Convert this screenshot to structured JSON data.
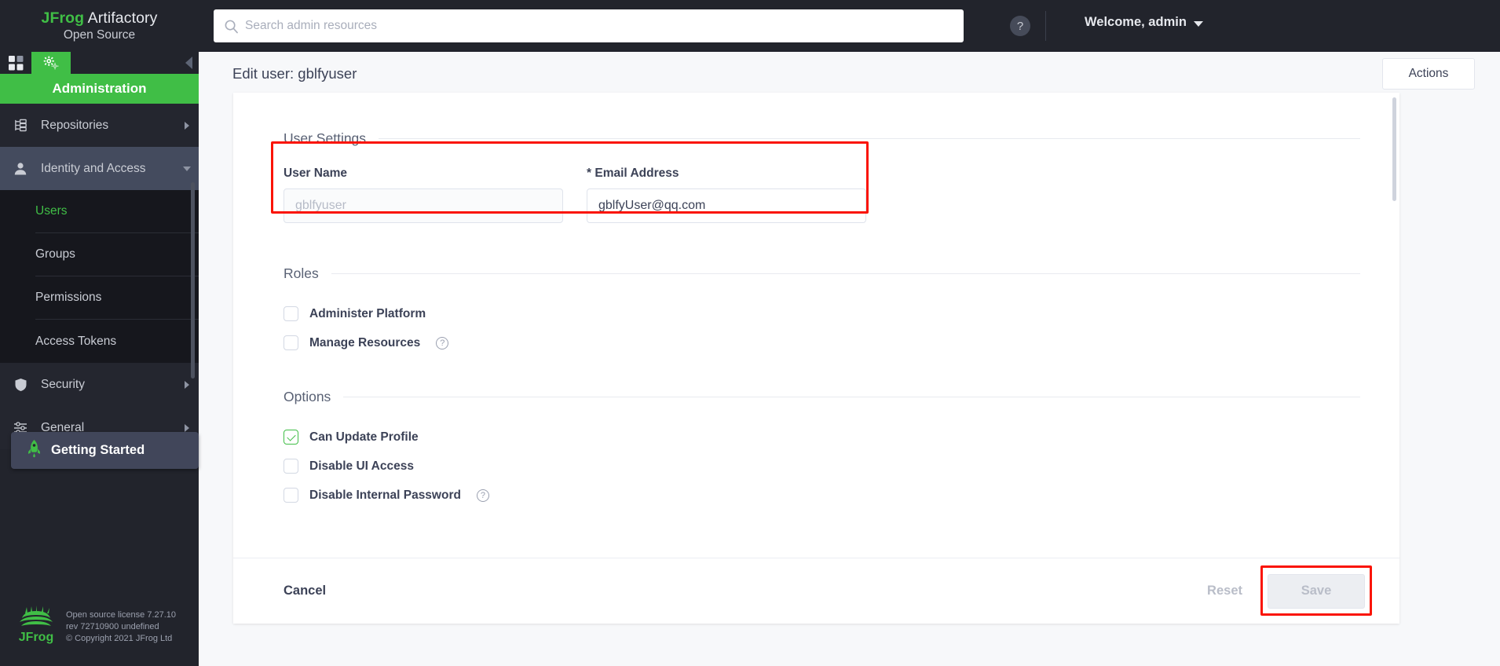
{
  "brand": {
    "name_strong": "JFrog",
    "name_rest": " Artifactory",
    "edition": "Open Source"
  },
  "search": {
    "placeholder": "Search admin resources",
    "value": "",
    "icon": "search-icon"
  },
  "topbar": {
    "help_label": "?",
    "welcome_label": "Welcome, admin"
  },
  "sidebar": {
    "module_title": "Administration",
    "apps_icon": "grid-apps-icon",
    "admin_icon": "gears-icon",
    "collapse_icon": "collapse-left-arrow-icon",
    "items": [
      {
        "label": "Repositories",
        "icon": "repositories-icon",
        "chevron": "chevron-right",
        "active": false
      },
      {
        "label": "Identity and Access",
        "icon": "user-icon",
        "chevron": "chevron-down",
        "active": true
      },
      {
        "label": "Security",
        "icon": "shield-icon",
        "chevron": "chevron-right",
        "active": false
      },
      {
        "label": "General",
        "icon": "sliders-icon",
        "chevron": "chevron-right",
        "active": false
      }
    ],
    "subitems": [
      {
        "label": "Users",
        "selected": true
      },
      {
        "label": "Groups",
        "selected": false
      },
      {
        "label": "Permissions",
        "selected": false
      },
      {
        "label": "Access Tokens",
        "selected": false
      }
    ],
    "getting_started": {
      "label": "Getting Started",
      "icon": "rocket-icon"
    },
    "footer": {
      "logo_icon": "jfrog-logo-icon",
      "line1": "Open source license 7.27.10",
      "line2": "rev 72710900 undefined",
      "line3": "© Copyright 2021 JFrog Ltd"
    }
  },
  "page": {
    "title": "Edit user: gblfyuser",
    "actions_label": "Actions"
  },
  "form": {
    "user_settings": {
      "section_label": "User Settings",
      "username": {
        "label": "User Name",
        "value": "",
        "placeholder": "gblfyuser",
        "disabled": true
      },
      "email": {
        "label_required_mark": "*",
        "label": "Email Address",
        "value": "gblfyUser@qq.com",
        "placeholder": ""
      }
    },
    "roles": {
      "section_label": "Roles",
      "items": [
        {
          "label": "Administer Platform",
          "checked": false,
          "help": false
        },
        {
          "label": "Manage Resources",
          "checked": false,
          "help": true,
          "help_label": "?"
        }
      ]
    },
    "options": {
      "section_label": "Options",
      "items": [
        {
          "label": "Can Update Profile",
          "checked": true,
          "help": false
        },
        {
          "label": "Disable UI Access",
          "checked": false,
          "help": false
        },
        {
          "label": "Disable Internal Password",
          "checked": false,
          "help": true,
          "help_label": "?"
        }
      ]
    },
    "footer": {
      "cancel_label": "Cancel",
      "reset_label": "Reset",
      "save_label": "Save"
    }
  },
  "colors": {
    "brand_green": "#40be46",
    "dark_nav": "#22242c",
    "highlight_red": "#fa1405",
    "text_primary": "#3c4257"
  }
}
